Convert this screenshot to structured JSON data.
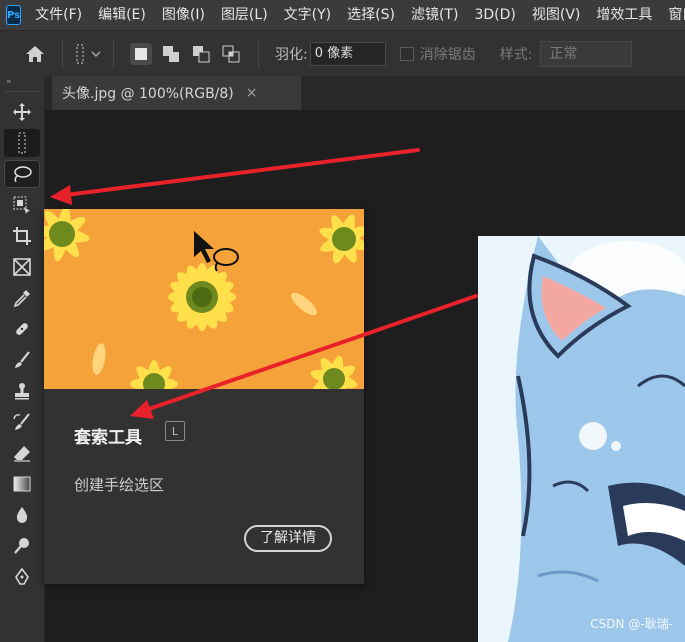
{
  "app": {
    "logo_text": "Ps"
  },
  "menubar": {
    "items": [
      {
        "label": "文件(F)"
      },
      {
        "label": "编辑(E)"
      },
      {
        "label": "图像(I)"
      },
      {
        "label": "图层(L)"
      },
      {
        "label": "文字(Y)"
      },
      {
        "label": "选择(S)"
      },
      {
        "label": "滤镜(T)"
      },
      {
        "label": "3D(D)"
      },
      {
        "label": "视图(V)"
      },
      {
        "label": "增效工具"
      },
      {
        "label": "窗口"
      }
    ]
  },
  "options": {
    "feather_label": "羽化:",
    "feather_value": "0 像素",
    "antialias_label": "消除锯齿",
    "style_label": "样式:",
    "style_value": "正常"
  },
  "toolbar": {
    "collapse_glyph": "»"
  },
  "document": {
    "tab_label": "头像.jpg @ 100%(RGB/8)",
    "close_glyph": "×"
  },
  "tooltip": {
    "title": "套索工具",
    "shortcut": "L",
    "description": "创建手绘选区",
    "learn_more": "了解详情"
  },
  "watermark": "CSDN @-耿瑞-",
  "colors": {
    "annotation_arrow": "#e8212b",
    "tooltip_image_bg": "#f5a23a",
    "ps_blue": "#31a8ff"
  }
}
